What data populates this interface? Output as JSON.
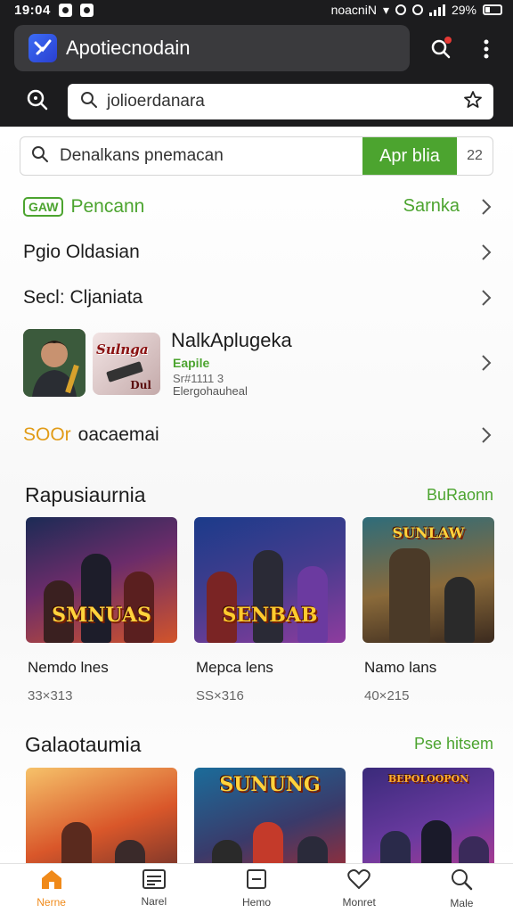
{
  "status_bar": {
    "time": "19:04",
    "carrier": "noacniN",
    "battery": "29%"
  },
  "header": {
    "app_title": "Apotiecnodain",
    "search_value": "jolioerdanara"
  },
  "search_row": {
    "placeholder": "Denalkans pnemacan",
    "button_label": "Apr blia",
    "count": "22"
  },
  "menu": [
    {
      "badge": "GAW",
      "label": "Pencann",
      "right": "Sarnka"
    },
    {
      "label": "Pgio Oldasian"
    },
    {
      "label": "Secl: Cljaniata"
    },
    {
      "prefix": "SOOr",
      "label": "oacaemai"
    }
  ],
  "app_item": {
    "title": "NalkAplugeka",
    "thumb2_text": "Sulnga",
    "thumb2_sub": "Dul",
    "tag": "Eapile",
    "meta": "Sr#1111 3",
    "sub": "Elergohauheal"
  },
  "section1": {
    "title": "Rapusiaurnia",
    "link": "BuRaonn",
    "cards": [
      {
        "logo": "SMNUAS",
        "name": "Nemdo lnes",
        "stat": "33×313"
      },
      {
        "logo": "SENBAB",
        "name": "Mepca lens",
        "stat": "SS×316"
      },
      {
        "logo": "SUNLAW",
        "name": "Namo lans",
        "stat": "40×215"
      }
    ]
  },
  "section2": {
    "title": "Galaotaumia",
    "link": "Pse hitsem",
    "cards": [
      {
        "logo": ""
      },
      {
        "logo": "SUNUNG"
      },
      {
        "logo": "BEPOLOOPON"
      }
    ]
  },
  "bottom_nav": [
    {
      "label": "Nerne",
      "icon": "home-icon"
    },
    {
      "label": "Narel",
      "icon": "list-icon"
    },
    {
      "label": "Hemo",
      "icon": "minus-box-icon"
    },
    {
      "label": "Monret",
      "icon": "heart-icon"
    },
    {
      "label": "Male",
      "icon": "search-icon"
    }
  ],
  "colors": {
    "accent_green": "#4ca42f",
    "accent_orange": "#f08a1a",
    "header_bg": "#1c1c1e"
  }
}
